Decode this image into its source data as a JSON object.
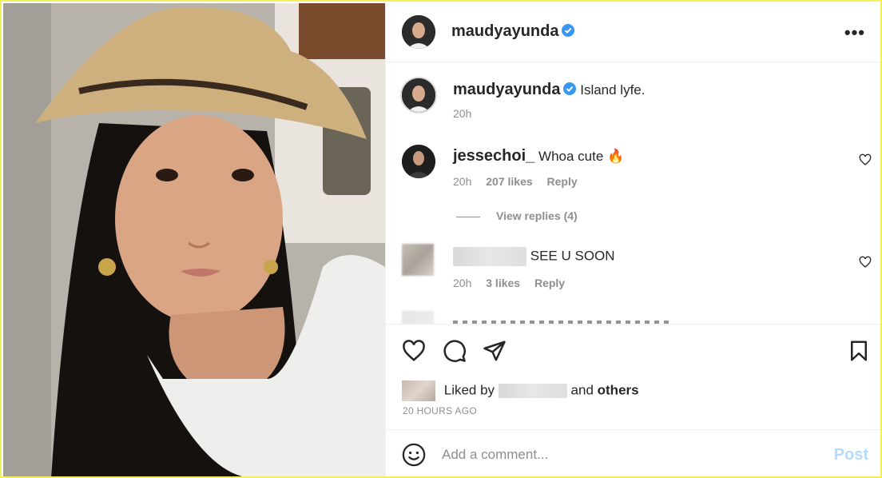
{
  "header": {
    "username": "maudyayunda",
    "more_label": "•••"
  },
  "caption": {
    "username": "maudyayunda",
    "text": "Island lyfe.",
    "time": "20h"
  },
  "comments": [
    {
      "username": "jessechoi_",
      "text": "Whoa cute 🔥",
      "time": "20h",
      "likes": "207 likes",
      "reply_label": "Reply",
      "view_replies": "View replies (4)"
    },
    {
      "username": "",
      "text": "SEE U SOON",
      "time": "20h",
      "likes": "3 likes",
      "reply_label": "Reply"
    }
  ],
  "likes_line": {
    "prefix": "Liked by",
    "connector": "and",
    "others": "others"
  },
  "time_ago": "20 HOURS AGO",
  "composer": {
    "placeholder": "Add a comment...",
    "post_label": "Post"
  },
  "icons": {
    "verified": "verified-badge-icon",
    "like": "heart-icon",
    "comment": "comment-bubble-icon",
    "share": "paper-plane-icon",
    "save": "bookmark-icon",
    "emoji": "smiley-icon",
    "more": "more-options-icon"
  },
  "colors": {
    "verified_blue": "#3897f0",
    "post_disabled": "#b3dbff",
    "muted_text": "#8e8e8e",
    "frame_border": "#f3ee5c"
  }
}
